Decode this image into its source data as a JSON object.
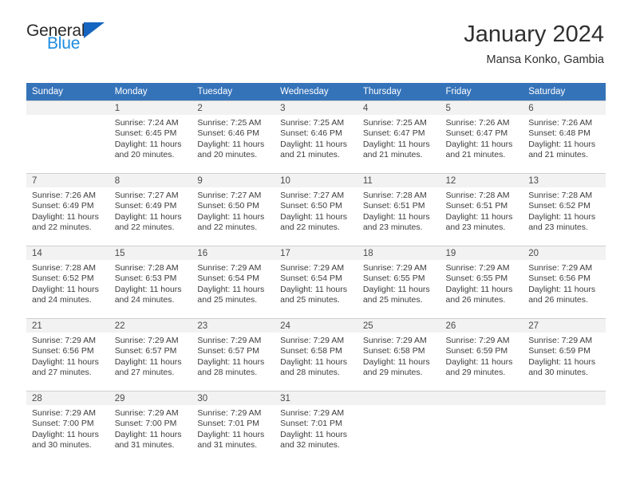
{
  "logo": {
    "text_primary": "General",
    "text_secondary": "Blue",
    "icon": "triangle-icon",
    "color_primary": "#2b2b2b",
    "color_secondary": "#1e8ce0",
    "triangle_color": "#1565c0"
  },
  "header": {
    "title": "January 2024",
    "subtitle": "Mansa Konko, Gambia"
  },
  "theme": {
    "header_row_bg": "#3573b9",
    "header_row_text": "#ffffff",
    "daynum_bg": "#f2f2f2",
    "grid_line": "#cfcfcf",
    "body_text": "#3d3d3d"
  },
  "weekday_headers": [
    "Sunday",
    "Monday",
    "Tuesday",
    "Wednesday",
    "Thursday",
    "Friday",
    "Saturday"
  ],
  "weeks": [
    [
      {
        "day": "",
        "empty": true,
        "sunrise": "",
        "sunset": "",
        "daylight_line1": "",
        "daylight_line2": ""
      },
      {
        "day": "1",
        "empty": false,
        "sunrise": "Sunrise: 7:24 AM",
        "sunset": "Sunset: 6:45 PM",
        "daylight_line1": "Daylight: 11 hours",
        "daylight_line2": "and 20 minutes."
      },
      {
        "day": "2",
        "empty": false,
        "sunrise": "Sunrise: 7:25 AM",
        "sunset": "Sunset: 6:46 PM",
        "daylight_line1": "Daylight: 11 hours",
        "daylight_line2": "and 20 minutes."
      },
      {
        "day": "3",
        "empty": false,
        "sunrise": "Sunrise: 7:25 AM",
        "sunset": "Sunset: 6:46 PM",
        "daylight_line1": "Daylight: 11 hours",
        "daylight_line2": "and 21 minutes."
      },
      {
        "day": "4",
        "empty": false,
        "sunrise": "Sunrise: 7:25 AM",
        "sunset": "Sunset: 6:47 PM",
        "daylight_line1": "Daylight: 11 hours",
        "daylight_line2": "and 21 minutes."
      },
      {
        "day": "5",
        "empty": false,
        "sunrise": "Sunrise: 7:26 AM",
        "sunset": "Sunset: 6:47 PM",
        "daylight_line1": "Daylight: 11 hours",
        "daylight_line2": "and 21 minutes."
      },
      {
        "day": "6",
        "empty": false,
        "sunrise": "Sunrise: 7:26 AM",
        "sunset": "Sunset: 6:48 PM",
        "daylight_line1": "Daylight: 11 hours",
        "daylight_line2": "and 21 minutes."
      }
    ],
    [
      {
        "day": "7",
        "empty": false,
        "sunrise": "Sunrise: 7:26 AM",
        "sunset": "Sunset: 6:49 PM",
        "daylight_line1": "Daylight: 11 hours",
        "daylight_line2": "and 22 minutes."
      },
      {
        "day": "8",
        "empty": false,
        "sunrise": "Sunrise: 7:27 AM",
        "sunset": "Sunset: 6:49 PM",
        "daylight_line1": "Daylight: 11 hours",
        "daylight_line2": "and 22 minutes."
      },
      {
        "day": "9",
        "empty": false,
        "sunrise": "Sunrise: 7:27 AM",
        "sunset": "Sunset: 6:50 PM",
        "daylight_line1": "Daylight: 11 hours",
        "daylight_line2": "and 22 minutes."
      },
      {
        "day": "10",
        "empty": false,
        "sunrise": "Sunrise: 7:27 AM",
        "sunset": "Sunset: 6:50 PM",
        "daylight_line1": "Daylight: 11 hours",
        "daylight_line2": "and 22 minutes."
      },
      {
        "day": "11",
        "empty": false,
        "sunrise": "Sunrise: 7:28 AM",
        "sunset": "Sunset: 6:51 PM",
        "daylight_line1": "Daylight: 11 hours",
        "daylight_line2": "and 23 minutes."
      },
      {
        "day": "12",
        "empty": false,
        "sunrise": "Sunrise: 7:28 AM",
        "sunset": "Sunset: 6:51 PM",
        "daylight_line1": "Daylight: 11 hours",
        "daylight_line2": "and 23 minutes."
      },
      {
        "day": "13",
        "empty": false,
        "sunrise": "Sunrise: 7:28 AM",
        "sunset": "Sunset: 6:52 PM",
        "daylight_line1": "Daylight: 11 hours",
        "daylight_line2": "and 23 minutes."
      }
    ],
    [
      {
        "day": "14",
        "empty": false,
        "sunrise": "Sunrise: 7:28 AM",
        "sunset": "Sunset: 6:52 PM",
        "daylight_line1": "Daylight: 11 hours",
        "daylight_line2": "and 24 minutes."
      },
      {
        "day": "15",
        "empty": false,
        "sunrise": "Sunrise: 7:28 AM",
        "sunset": "Sunset: 6:53 PM",
        "daylight_line1": "Daylight: 11 hours",
        "daylight_line2": "and 24 minutes."
      },
      {
        "day": "16",
        "empty": false,
        "sunrise": "Sunrise: 7:29 AM",
        "sunset": "Sunset: 6:54 PM",
        "daylight_line1": "Daylight: 11 hours",
        "daylight_line2": "and 25 minutes."
      },
      {
        "day": "17",
        "empty": false,
        "sunrise": "Sunrise: 7:29 AM",
        "sunset": "Sunset: 6:54 PM",
        "daylight_line1": "Daylight: 11 hours",
        "daylight_line2": "and 25 minutes."
      },
      {
        "day": "18",
        "empty": false,
        "sunrise": "Sunrise: 7:29 AM",
        "sunset": "Sunset: 6:55 PM",
        "daylight_line1": "Daylight: 11 hours",
        "daylight_line2": "and 25 minutes."
      },
      {
        "day": "19",
        "empty": false,
        "sunrise": "Sunrise: 7:29 AM",
        "sunset": "Sunset: 6:55 PM",
        "daylight_line1": "Daylight: 11 hours",
        "daylight_line2": "and 26 minutes."
      },
      {
        "day": "20",
        "empty": false,
        "sunrise": "Sunrise: 7:29 AM",
        "sunset": "Sunset: 6:56 PM",
        "daylight_line1": "Daylight: 11 hours",
        "daylight_line2": "and 26 minutes."
      }
    ],
    [
      {
        "day": "21",
        "empty": false,
        "sunrise": "Sunrise: 7:29 AM",
        "sunset": "Sunset: 6:56 PM",
        "daylight_line1": "Daylight: 11 hours",
        "daylight_line2": "and 27 minutes."
      },
      {
        "day": "22",
        "empty": false,
        "sunrise": "Sunrise: 7:29 AM",
        "sunset": "Sunset: 6:57 PM",
        "daylight_line1": "Daylight: 11 hours",
        "daylight_line2": "and 27 minutes."
      },
      {
        "day": "23",
        "empty": false,
        "sunrise": "Sunrise: 7:29 AM",
        "sunset": "Sunset: 6:57 PM",
        "daylight_line1": "Daylight: 11 hours",
        "daylight_line2": "and 28 minutes."
      },
      {
        "day": "24",
        "empty": false,
        "sunrise": "Sunrise: 7:29 AM",
        "sunset": "Sunset: 6:58 PM",
        "daylight_line1": "Daylight: 11 hours",
        "daylight_line2": "and 28 minutes."
      },
      {
        "day": "25",
        "empty": false,
        "sunrise": "Sunrise: 7:29 AM",
        "sunset": "Sunset: 6:58 PM",
        "daylight_line1": "Daylight: 11 hours",
        "daylight_line2": "and 29 minutes."
      },
      {
        "day": "26",
        "empty": false,
        "sunrise": "Sunrise: 7:29 AM",
        "sunset": "Sunset: 6:59 PM",
        "daylight_line1": "Daylight: 11 hours",
        "daylight_line2": "and 29 minutes."
      },
      {
        "day": "27",
        "empty": false,
        "sunrise": "Sunrise: 7:29 AM",
        "sunset": "Sunset: 6:59 PM",
        "daylight_line1": "Daylight: 11 hours",
        "daylight_line2": "and 30 minutes."
      }
    ],
    [
      {
        "day": "28",
        "empty": false,
        "sunrise": "Sunrise: 7:29 AM",
        "sunset": "Sunset: 7:00 PM",
        "daylight_line1": "Daylight: 11 hours",
        "daylight_line2": "and 30 minutes."
      },
      {
        "day": "29",
        "empty": false,
        "sunrise": "Sunrise: 7:29 AM",
        "sunset": "Sunset: 7:00 PM",
        "daylight_line1": "Daylight: 11 hours",
        "daylight_line2": "and 31 minutes."
      },
      {
        "day": "30",
        "empty": false,
        "sunrise": "Sunrise: 7:29 AM",
        "sunset": "Sunset: 7:01 PM",
        "daylight_line1": "Daylight: 11 hours",
        "daylight_line2": "and 31 minutes."
      },
      {
        "day": "31",
        "empty": false,
        "sunrise": "Sunrise: 7:29 AM",
        "sunset": "Sunset: 7:01 PM",
        "daylight_line1": "Daylight: 11 hours",
        "daylight_line2": "and 32 minutes."
      },
      {
        "day": "",
        "empty": true,
        "sunrise": "",
        "sunset": "",
        "daylight_line1": "",
        "daylight_line2": ""
      },
      {
        "day": "",
        "empty": true,
        "sunrise": "",
        "sunset": "",
        "daylight_line1": "",
        "daylight_line2": ""
      },
      {
        "day": "",
        "empty": true,
        "sunrise": "",
        "sunset": "",
        "daylight_line1": "",
        "daylight_line2": ""
      }
    ]
  ]
}
